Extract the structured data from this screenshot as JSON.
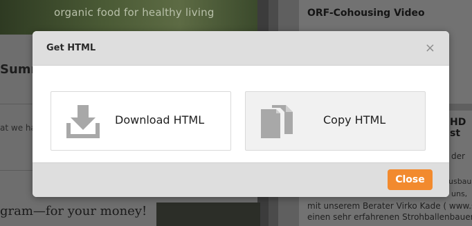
{
  "background": {
    "tagline": "organic food for healthy living",
    "left_heading": "Summ",
    "left_snippet": "at we ha",
    "left_program": "gram—for your money!",
    "right_title": "ORF-Cohousing Video",
    "right_title2": "HD st",
    "right_der": "der",
    "right_usbau": "usbau",
    "right_uns": "uns,",
    "right_text1": "mit unserem Berater Virko Kade ( www.s",
    "right_text2": "einen sehr erfahrenen Strohballenbauer"
  },
  "modal": {
    "title": "Get HTML",
    "close_x": "×",
    "options": [
      {
        "label": "Download HTML",
        "icon": "download-icon"
      },
      {
        "label": "Copy HTML",
        "icon": "copy-icon"
      }
    ],
    "close_button": "Close"
  },
  "colors": {
    "accent": "#f28a2e",
    "header_bg": "#dedede",
    "icon_gray": "#a8a8a8"
  }
}
